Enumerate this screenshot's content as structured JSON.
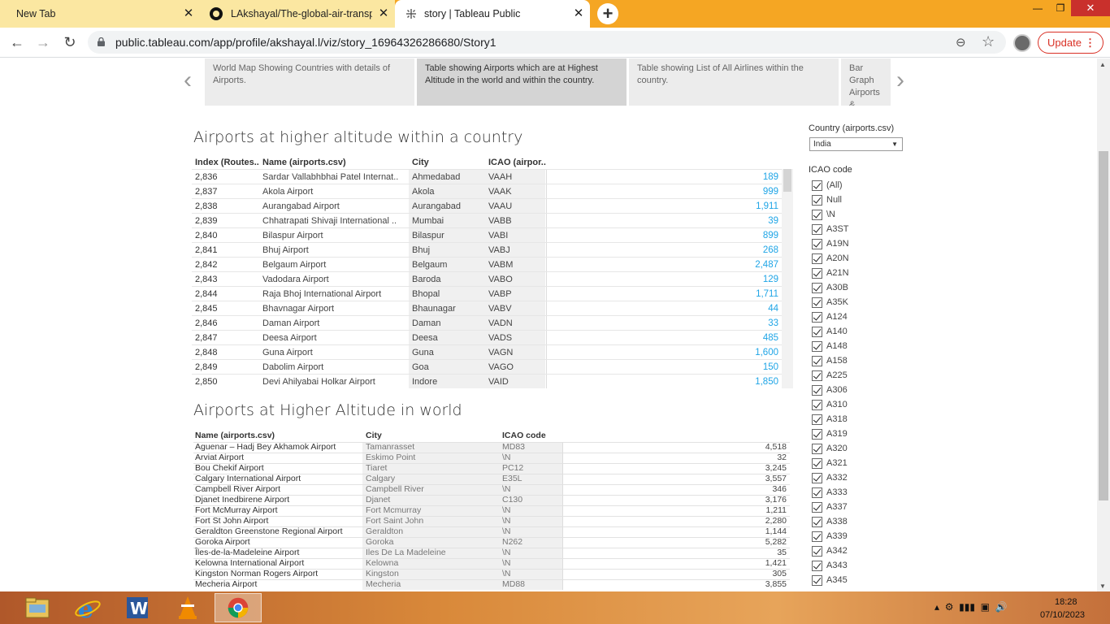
{
  "browser": {
    "tabs": [
      {
        "title": "New Tab"
      },
      {
        "title": "LAkshayal/The-global-air-transpo"
      },
      {
        "title": "story | Tableau Public"
      }
    ],
    "url": "public.tableau.com/app/profile/akshayal.l/viz/story_16964326286680/Story1",
    "update_label": "Update"
  },
  "story": {
    "points": [
      {
        "caption": "World Map Showing Countries with details of Airports."
      },
      {
        "caption": "Table showing Airports which are at Highest Altitude in the world and within the country."
      },
      {
        "caption": "Table showing List of All Airlines within the country."
      },
      {
        "caption": "Bar Graph Airports &"
      }
    ]
  },
  "sheet1": {
    "title": "Airports at higher altitude within a country",
    "headers": [
      "Index (Routes..",
      "Name (airports.csv)",
      "City",
      "ICAO (airpor.."
    ],
    "rows": [
      {
        "index": "2,836",
        "name": "Sardar Vallabhbhai Patel Internat..",
        "city": "Ahmedabad",
        "icao": "VAAH",
        "value": "189"
      },
      {
        "index": "2,837",
        "name": "Akola Airport",
        "city": "Akola",
        "icao": "VAAK",
        "value": "999"
      },
      {
        "index": "2,838",
        "name": "Aurangabad Airport",
        "city": "Aurangabad",
        "icao": "VAAU",
        "value": "1,911"
      },
      {
        "index": "2,839",
        "name": "Chhatrapati Shivaji International ..",
        "city": "Mumbai",
        "icao": "VABB",
        "value": "39"
      },
      {
        "index": "2,840",
        "name": "Bilaspur Airport",
        "city": "Bilaspur",
        "icao": "VABI",
        "value": "899"
      },
      {
        "index": "2,841",
        "name": "Bhuj Airport",
        "city": "Bhuj",
        "icao": "VABJ",
        "value": "268"
      },
      {
        "index": "2,842",
        "name": "Belgaum Airport",
        "city": "Belgaum",
        "icao": "VABM",
        "value": "2,487"
      },
      {
        "index": "2,843",
        "name": "Vadodara Airport",
        "city": "Baroda",
        "icao": "VABO",
        "value": "129"
      },
      {
        "index": "2,844",
        "name": "Raja Bhoj International Airport",
        "city": "Bhopal",
        "icao": "VABP",
        "value": "1,711"
      },
      {
        "index": "2,845",
        "name": "Bhavnagar Airport",
        "city": "Bhaunagar",
        "icao": "VABV",
        "value": "44"
      },
      {
        "index": "2,846",
        "name": "Daman Airport",
        "city": "Daman",
        "icao": "VADN",
        "value": "33"
      },
      {
        "index": "2,847",
        "name": "Deesa Airport",
        "city": "Deesa",
        "icao": "VADS",
        "value": "485"
      },
      {
        "index": "2,848",
        "name": "Guna Airport",
        "city": "Guna",
        "icao": "VAGN",
        "value": "1,600"
      },
      {
        "index": "2,849",
        "name": "Dabolim Airport",
        "city": "Goa",
        "icao": "VAGO",
        "value": "150"
      },
      {
        "index": "2,850",
        "name": "Devi Ahilyabai Holkar Airport",
        "city": "Indore",
        "icao": "VAID",
        "value": "1,850"
      }
    ]
  },
  "sheet2": {
    "title": "Airports at Higher Altitude in world",
    "headers": [
      "Name (airports.csv)",
      "City",
      "ICAO code"
    ],
    "rows": [
      {
        "name": "Aguenar – Hadj Bey Akhamok Airport",
        "city": "Tamanrasset",
        "icao": "MD83",
        "value": "4,518"
      },
      {
        "name": "Arviat Airport",
        "city": "Eskimo Point",
        "icao": "\\N",
        "value": "32"
      },
      {
        "name": "Bou Chekif Airport",
        "city": "Tiaret",
        "icao": "PC12",
        "value": "3,245"
      },
      {
        "name": "Calgary International Airport",
        "city": "Calgary",
        "icao": "E35L",
        "value": "3,557"
      },
      {
        "name": "Campbell River Airport",
        "city": "Campbell River",
        "icao": "\\N",
        "value": "346"
      },
      {
        "name": "Djanet Inedbirene Airport",
        "city": "Djanet",
        "icao": "C130",
        "value": "3,176"
      },
      {
        "name": "Fort McMurray Airport",
        "city": "Fort Mcmurray",
        "icao": "\\N",
        "value": "1,211"
      },
      {
        "name": "Fort St John Airport",
        "city": "Fort Saint John",
        "icao": "\\N",
        "value": "2,280"
      },
      {
        "name": "Geraldton Greenstone Regional Airport",
        "city": "Geraldton",
        "icao": "\\N",
        "value": "1,144"
      },
      {
        "name": "Goroka Airport",
        "city": "Goroka",
        "icao": "N262",
        "value": "5,282"
      },
      {
        "name": "Îles-de-la-Madeleine Airport",
        "city": "Iles De La Madeleine",
        "icao": "\\N",
        "value": "35"
      },
      {
        "name": "Kelowna International Airport",
        "city": "Kelowna",
        "icao": "\\N",
        "value": "1,421"
      },
      {
        "name": "Kingston Norman Rogers Airport",
        "city": "Kingston",
        "icao": "\\N",
        "value": "305"
      },
      {
        "name": "Mecheria Airport",
        "city": "Mecheria",
        "icao": "MD88",
        "value": "3,855"
      }
    ]
  },
  "filters": {
    "country_label": "Country (airports.csv)",
    "country_value": "India",
    "icao_label": "ICAO code",
    "icao_items": [
      "(All)",
      "Null",
      "\\N",
      "A3ST",
      "A19N",
      "A20N",
      "A21N",
      "A30B",
      "A35K",
      "A124",
      "A140",
      "A148",
      "A158",
      "A225",
      "A306",
      "A310",
      "A318",
      "A319",
      "A320",
      "A321",
      "A332",
      "A333",
      "A337",
      "A338",
      "A339",
      "A342",
      "A343",
      "A345"
    ]
  },
  "taskbar": {
    "time": "18:28",
    "date": "07/10/2023"
  },
  "colors": {
    "tab_strip": "#f5a623",
    "update_accent": "#d93025",
    "measure_value": "#1fa5e6"
  },
  "icons": [
    "github-icon",
    "tableau-icon",
    "lock-icon",
    "zoom-icon",
    "star-icon",
    "chrome-icon",
    "ie-icon",
    "word-icon",
    "vlc-icon",
    "explorer-icon"
  ]
}
